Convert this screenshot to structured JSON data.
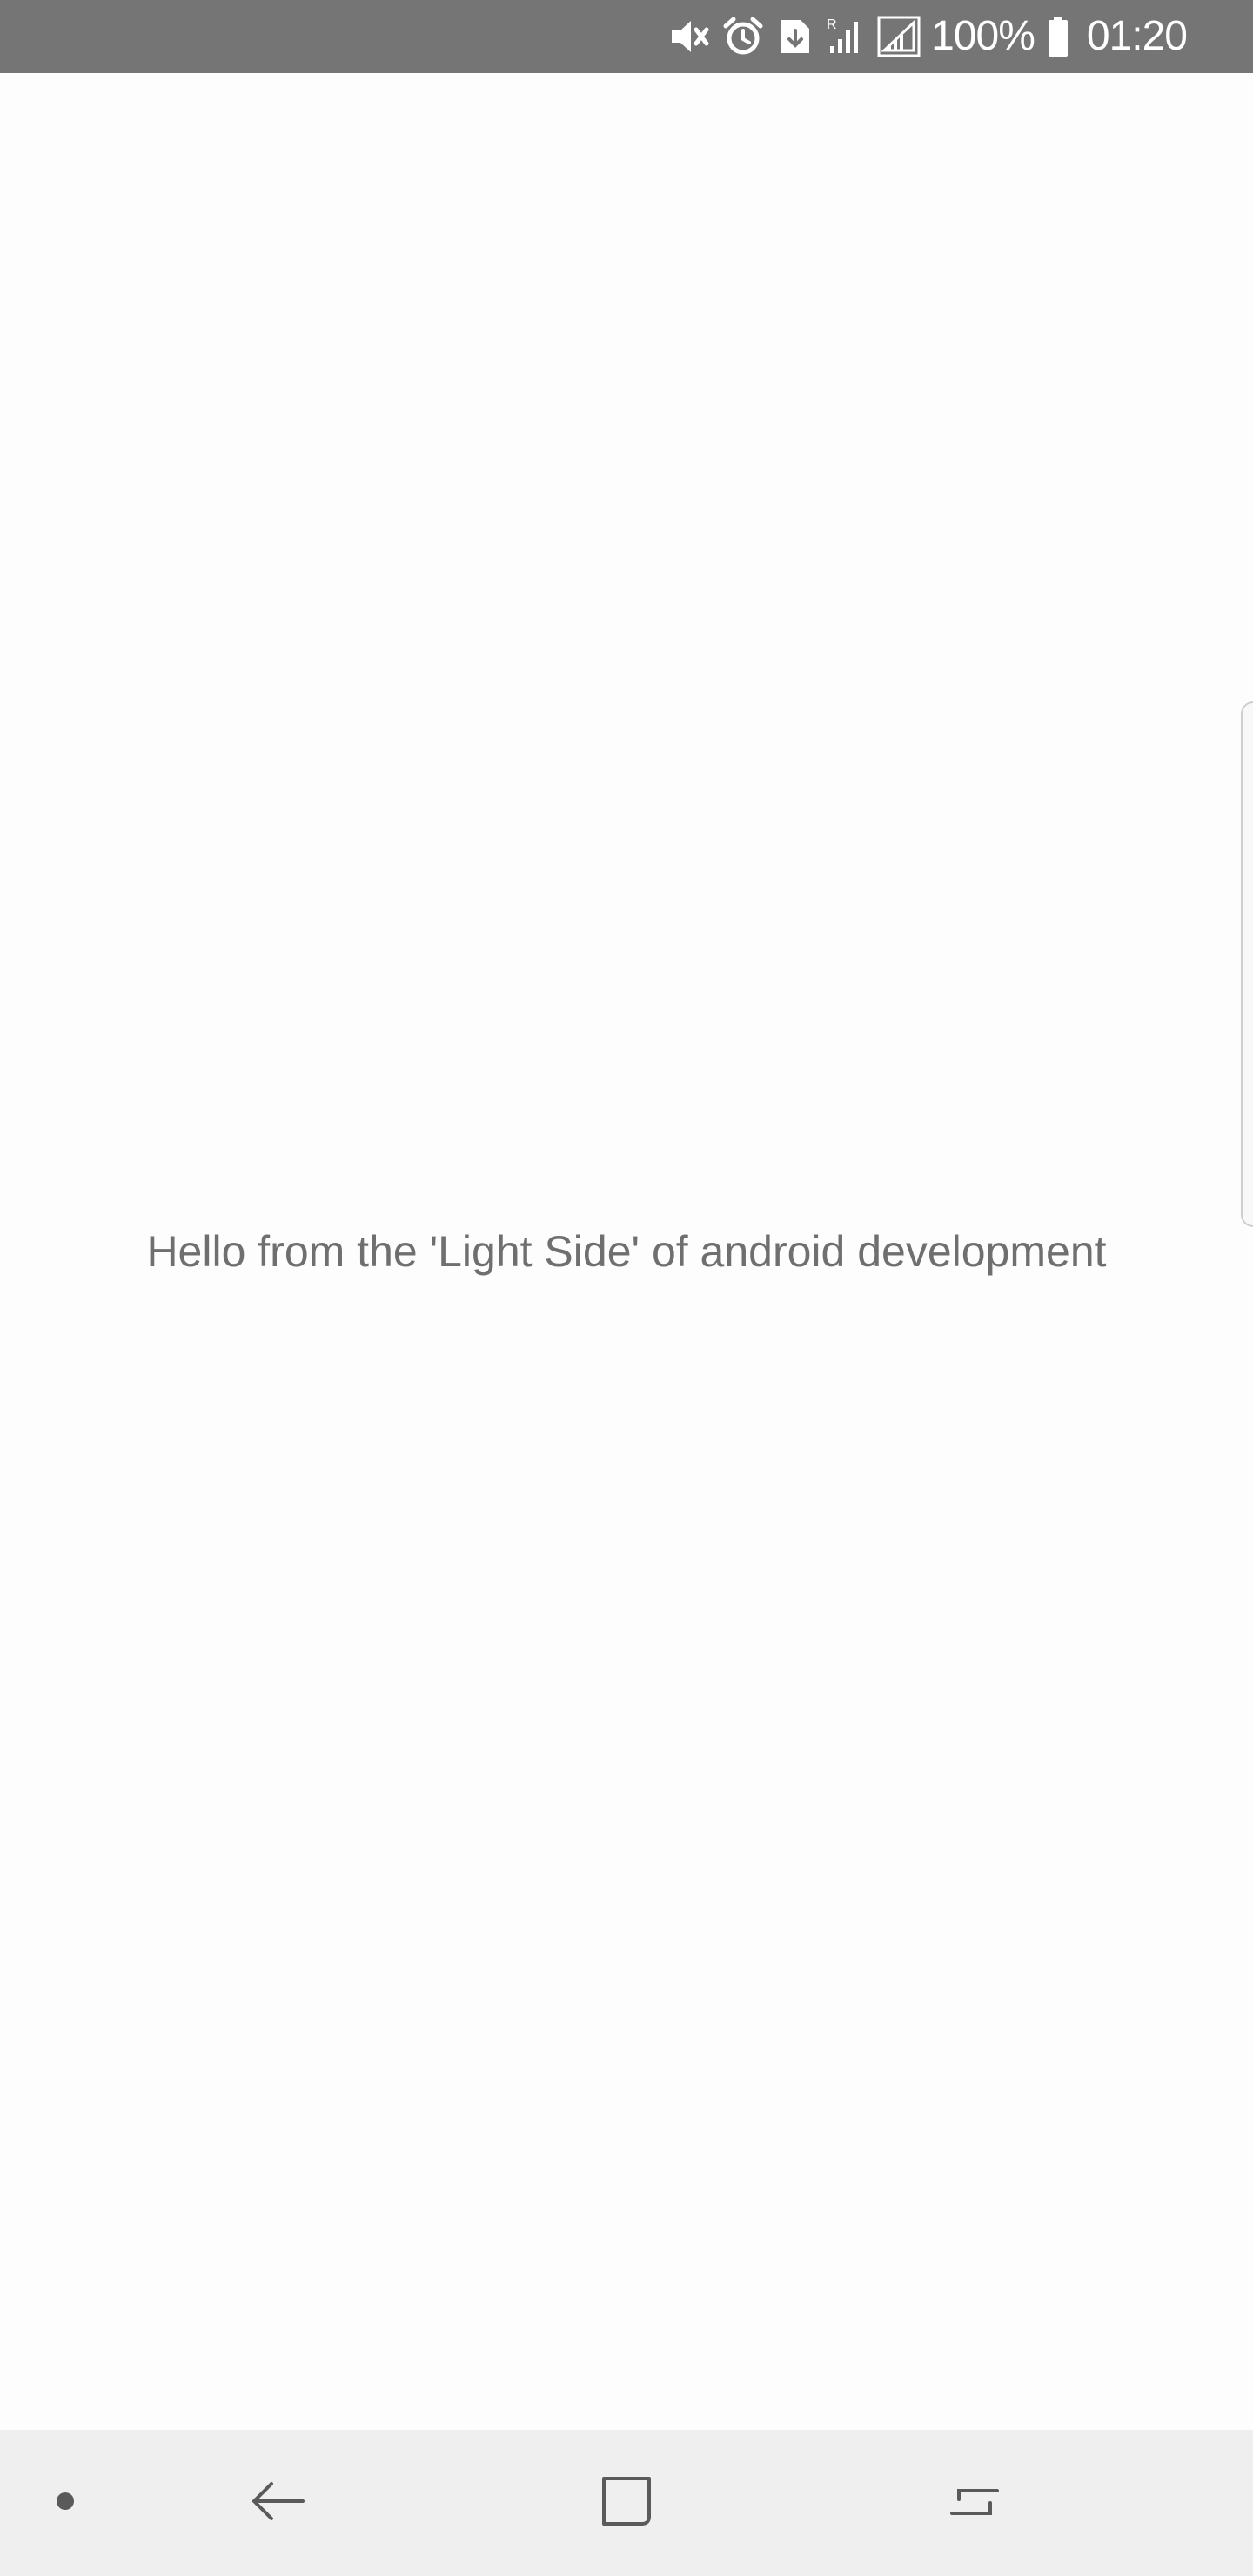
{
  "status_bar": {
    "icons": [
      "mute-icon",
      "alarm-icon",
      "download-icon",
      "roaming-signal-icon",
      "signal-icon",
      "battery-icon"
    ],
    "battery_percent": "100%",
    "time": "01:20",
    "background_color": "#757575"
  },
  "content": {
    "message": "Hello from the 'Light Side' of android development",
    "background_color": "#fdfdfd",
    "text_color": "#6f6f6f"
  },
  "nav_bar": {
    "buttons": [
      "dot-icon",
      "back-icon",
      "home-icon",
      "recent-apps-icon"
    ],
    "background_color": "#efefef"
  }
}
